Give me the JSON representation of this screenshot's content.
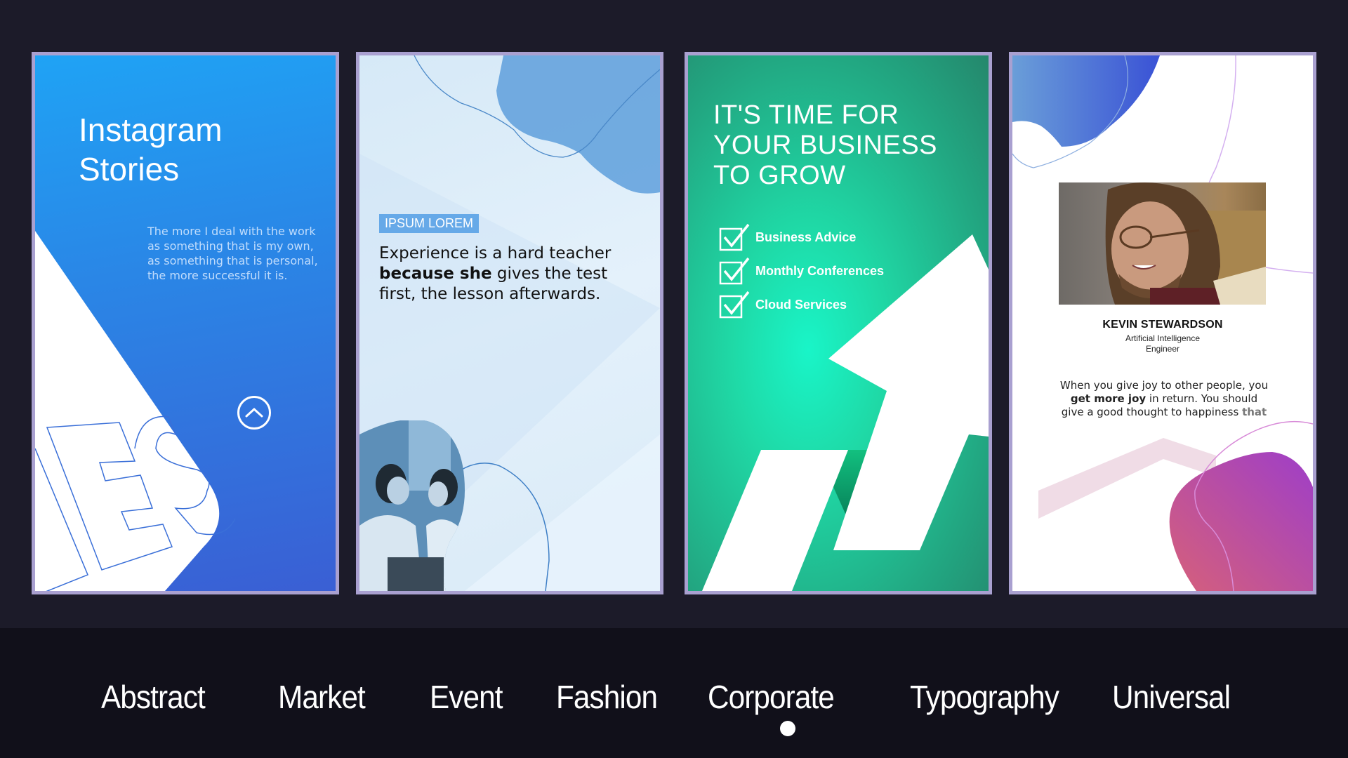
{
  "cards": [
    {
      "id": "abstract",
      "title_line1": "Instagram",
      "title_line2": "Stories",
      "quote": "The more I deal with the work as something that is my own, as something that is personal, the more successful it is.",
      "outline_letters": "ES",
      "icon": "chevron-up-circle-icon",
      "colors": {
        "gradient_top": "#1fa3f5",
        "gradient_bottom": "#3a5fd4"
      }
    },
    {
      "id": "market",
      "badge": "IPSUM LOREM",
      "quote_pre": "Experience is a hard teacher ",
      "quote_bold": "because she",
      "quote_post": " gives the test first, the lesson afterwards.",
      "photo": "two-women-laughing-photo",
      "colors": {
        "badge": "#66a9e8",
        "blob": "#5e9fdc"
      }
    },
    {
      "id": "corporate",
      "title_line1": "IT'S TIME FOR",
      "title_line2": "YOUR BUSINESS",
      "title_line3": "TO GROW",
      "checklist": [
        {
          "label": "Business Advice",
          "icon": "checkbox-checked-icon"
        },
        {
          "label": "Monthly Conferences",
          "icon": "checkbox-checked-icon"
        },
        {
          "label": "Cloud Services",
          "icon": "checkbox-checked-icon"
        }
      ],
      "graphic": "growth-arrow",
      "colors": {
        "accent": "#19f5c8",
        "base": "#24876c"
      }
    },
    {
      "id": "profile",
      "name": "KEVIN STEWARDSON",
      "role_line1": "Artificial Intelligence",
      "role_line2": "Engineer",
      "quote_pre": "When you give joy to other people, you ",
      "quote_bold": "get more joy",
      "quote_post": " in return. You should give a good thought to happiness ",
      "quote_fade": "that",
      "photo": "smiling-man-glasses-photo",
      "colors": {
        "blob_top": "#3d5bd6",
        "blob_bottom_a": "#d4607a",
        "blob_bottom_b": "#a23ec0"
      }
    }
  ],
  "nav": {
    "items": [
      {
        "label": "Abstract"
      },
      {
        "label": "Market"
      },
      {
        "label": "Event"
      },
      {
        "label": "Fashion"
      },
      {
        "label": "Corporate"
      },
      {
        "label": "Typography"
      },
      {
        "label": "Universal"
      }
    ],
    "active_index": 4
  },
  "colors": {
    "background": "#1c1b29",
    "band": "#11101a",
    "card_border": "#a9a0d0"
  }
}
